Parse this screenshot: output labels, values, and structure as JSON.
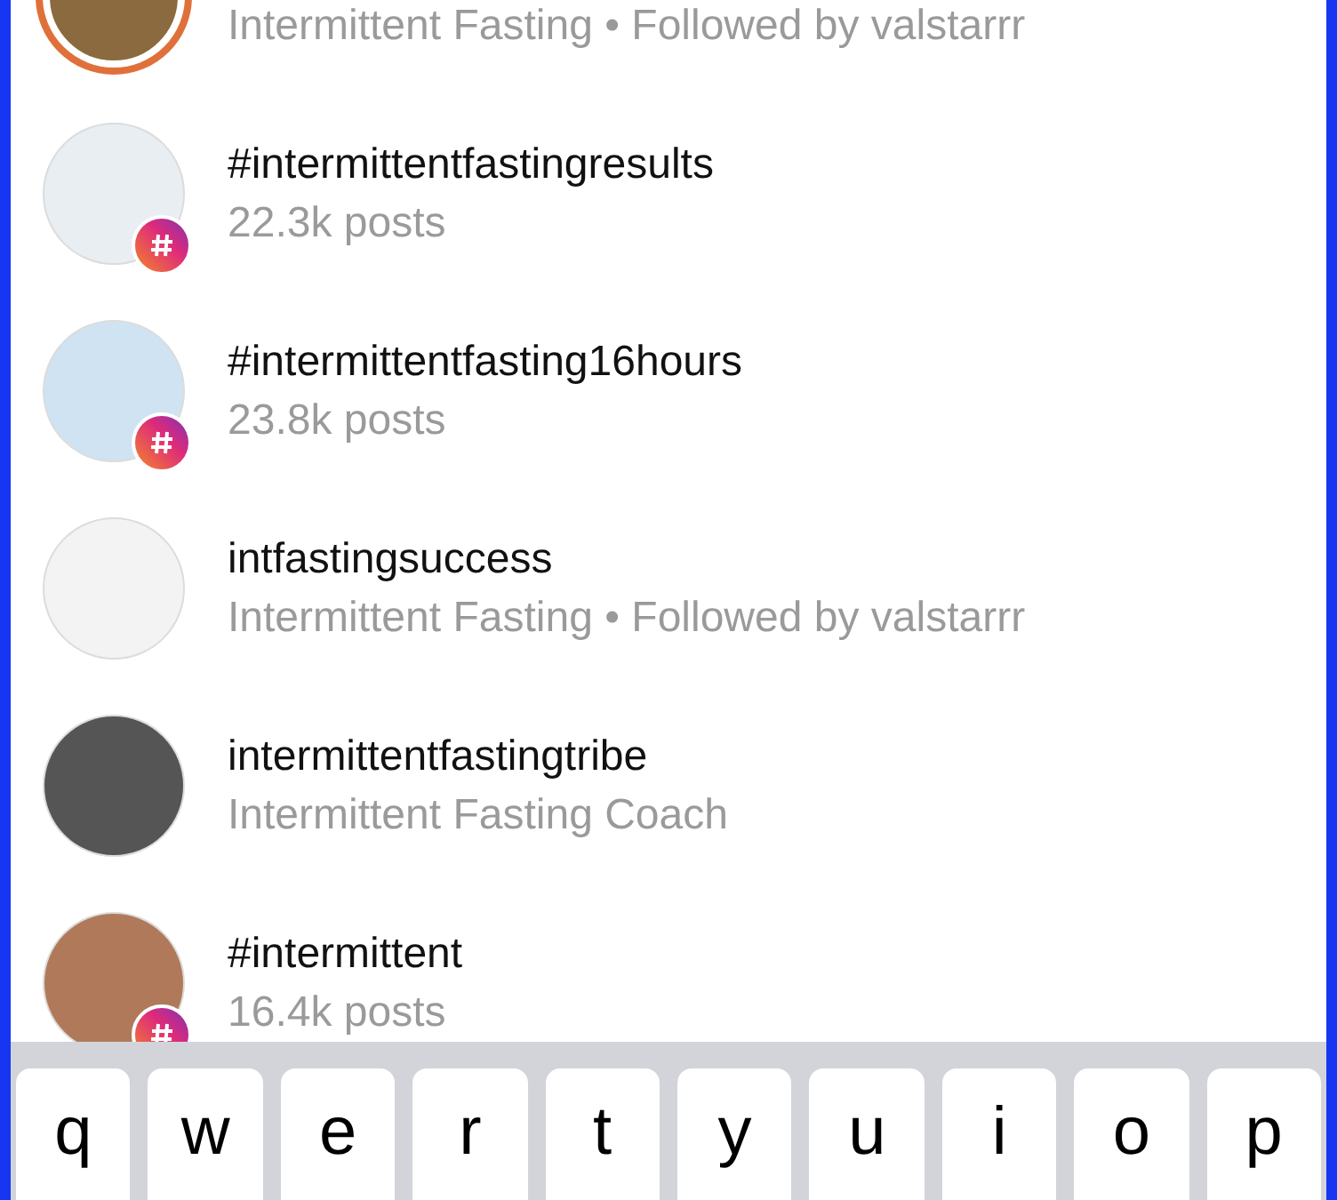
{
  "results": [
    {
      "kind": "account",
      "story_ring": true,
      "subtitle": "Intermittent Fasting • Followed by valstarrr"
    },
    {
      "kind": "hashtag",
      "story_ring": false,
      "title": "#intermittentfastingresults",
      "subtitle": "22.3k posts"
    },
    {
      "kind": "hashtag",
      "story_ring": false,
      "title": "#intermittentfasting16hours",
      "subtitle": "23.8k posts"
    },
    {
      "kind": "account",
      "story_ring": false,
      "title": "intfastingsuccess",
      "subtitle": "Intermittent Fasting • Followed by valstarrr"
    },
    {
      "kind": "account",
      "story_ring": false,
      "title": "intermittentfastingtribe",
      "subtitle": "Intermittent Fasting Coach"
    },
    {
      "kind": "hashtag",
      "story_ring": false,
      "title": "#intermittent",
      "subtitle": "16.4k posts"
    }
  ],
  "keyboard": {
    "keys": [
      "q",
      "w",
      "e",
      "r",
      "t",
      "y",
      "u",
      "i",
      "o",
      "p"
    ]
  }
}
